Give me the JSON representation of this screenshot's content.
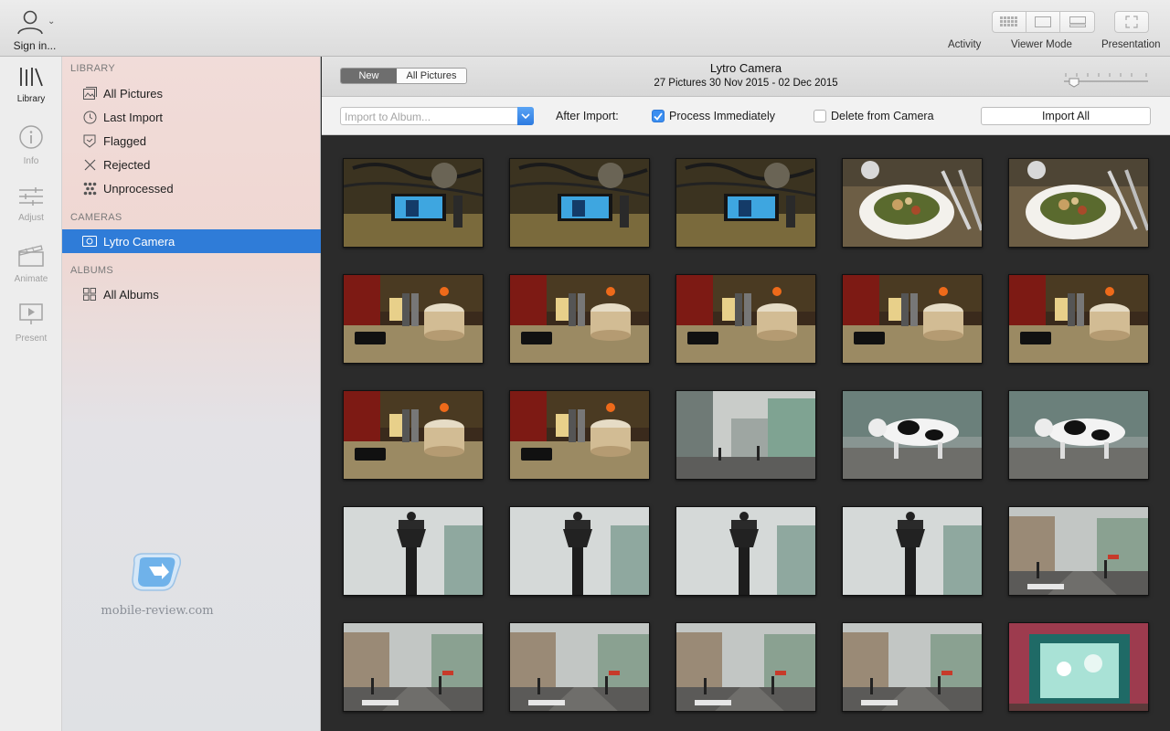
{
  "toolbar": {
    "sign_in": "Sign in...",
    "activity": "Activity",
    "viewer_mode": "Viewer Mode",
    "presentation": "Presentation"
  },
  "rail": {
    "library": "Library",
    "info": "Info",
    "adjust": "Adjust",
    "animate": "Animate",
    "present": "Present"
  },
  "sidebar": {
    "library_header": "LIBRARY",
    "library_items": [
      "All Pictures",
      "Last Import",
      "Flagged",
      "Rejected",
      "Unprocessed"
    ],
    "cameras_header": "CAMERAS",
    "camera_item": "Lytro Camera",
    "albums_header": "ALBUMS",
    "albums_item": "All Albums"
  },
  "watermark": "mobile-review.com",
  "header": {
    "toggle_new": "New",
    "toggle_all": "All Pictures",
    "title": "Lytro Camera",
    "subtitle": "27 Pictures  30 Nov 2015 - 02 Dec 2015"
  },
  "import_bar": {
    "album_placeholder": "Import to Album...",
    "after_import": "After Import:",
    "process_immediately": "Process Immediately",
    "delete_from_camera": "Delete from Camera",
    "import_all": "Import All"
  },
  "colors": {
    "accent": "#2f7cd8",
    "grid_background": "#2b2b2b"
  },
  "thumbnails": [
    {
      "scene": "desk-phone"
    },
    {
      "scene": "desk-phone"
    },
    {
      "scene": "desk-phone"
    },
    {
      "scene": "salad-bowl"
    },
    {
      "scene": "salad-bowl"
    },
    {
      "scene": "cafe-coffee"
    },
    {
      "scene": "cafe-coffee"
    },
    {
      "scene": "cafe-coffee"
    },
    {
      "scene": "cafe-coffee"
    },
    {
      "scene": "cafe-coffee"
    },
    {
      "scene": "cafe-coffee"
    },
    {
      "scene": "cafe-coffee"
    },
    {
      "scene": "street-corner"
    },
    {
      "scene": "cow-sculpture"
    },
    {
      "scene": "cow-sculpture"
    },
    {
      "scene": "street-lamp"
    },
    {
      "scene": "street-lamp"
    },
    {
      "scene": "street-lamp"
    },
    {
      "scene": "street-lamp"
    },
    {
      "scene": "street-view"
    },
    {
      "scene": "street-view"
    },
    {
      "scene": "street-view"
    },
    {
      "scene": "street-view"
    },
    {
      "scene": "street-view"
    },
    {
      "scene": "shop-window"
    }
  ]
}
